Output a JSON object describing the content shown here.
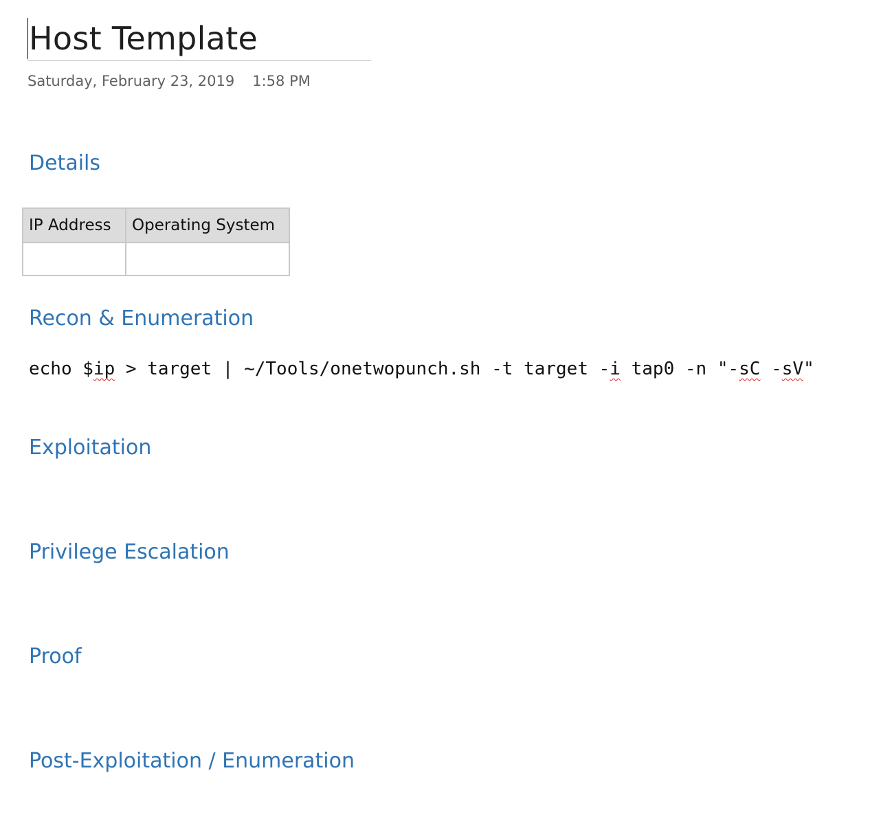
{
  "page": {
    "title": "Host Template",
    "date": "Saturday, February 23, 2019",
    "time": "1:58 PM"
  },
  "sections": {
    "details": "Details",
    "recon": "Recon & Enumeration",
    "exploitation": "Exploitation",
    "privesc": "Privilege Escalation",
    "proof": "Proof",
    "post": "Post-Exploitation / Enumeration"
  },
  "details_table": {
    "headers": [
      "IP Address",
      "Operating System"
    ],
    "rows": [
      [
        "",
        ""
      ]
    ]
  },
  "command": {
    "p1": "echo $",
    "p2": "ip",
    "p3": " > target | ~/Tools/onetwopunch.sh -t target -",
    "p4": "i",
    "p5": " tap0 -n \"-",
    "p6": "sC",
    "p7": " -",
    "p8": "sV",
    "p9": "\""
  },
  "colors": {
    "heading": "#2e74b5",
    "date_text": "#616161",
    "table_header_bg": "#dcdcdc",
    "table_border": "#c8c8c8",
    "spellcheck": "#e02020"
  }
}
